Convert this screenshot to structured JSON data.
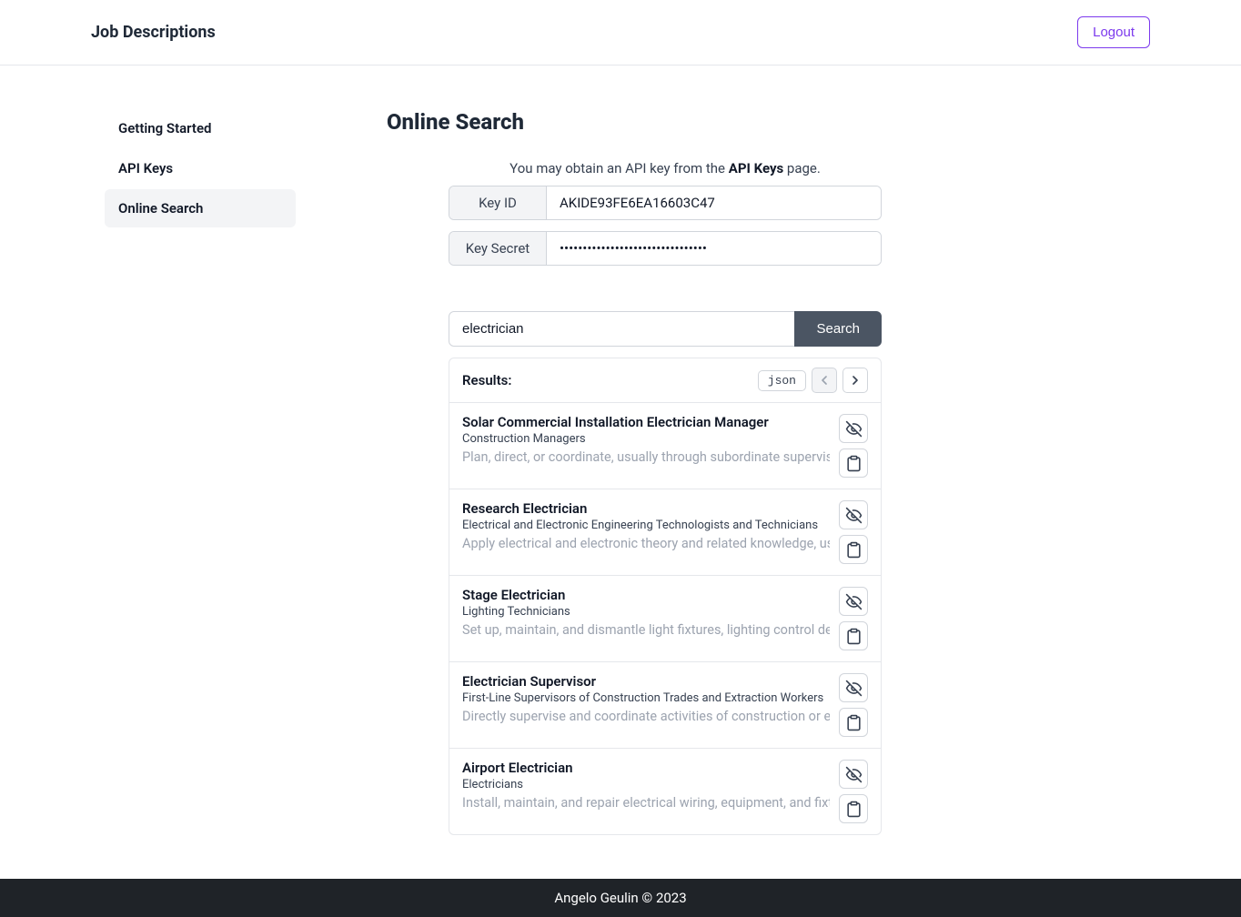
{
  "header": {
    "title": "Job Descriptions",
    "logout": "Logout"
  },
  "sidebar": {
    "items": [
      {
        "label": "Getting Started",
        "active": false
      },
      {
        "label": "API Keys",
        "active": false
      },
      {
        "label": "Online Search",
        "active": true
      }
    ]
  },
  "page": {
    "title": "Online Search",
    "info_prefix": "You may obtain an API key from the ",
    "info_link": "API Keys",
    "info_suffix": " page.",
    "key_id_label": "Key ID",
    "key_id_value": "AKIDE93FE6EA16603C47",
    "key_secret_label": "Key Secret",
    "key_secret_value": "••••••••••••••••••••••••••••••••",
    "search_value": "electrician",
    "search_button": "Search",
    "results_label": "Results:",
    "json_badge": "json"
  },
  "results": [
    {
      "title": "Solar Commercial Installation Electrician Manager",
      "category": "Construction Managers",
      "description": "Plan, direct, or coordinate, usually through subordinate supervisory p …"
    },
    {
      "title": "Research Electrician",
      "category": "Electrical and Electronic Engineering Technologists and Technicians",
      "description": "Apply electrical and electronic theory and related knowledge, usually …"
    },
    {
      "title": "Stage Electrician",
      "category": "Lighting Technicians",
      "description": "Set up, maintain, and dismantle light fixtures, lighting control devic …"
    },
    {
      "title": "Electrician Supervisor",
      "category": "First-Line Supervisors of Construction Trades and Extraction Workers",
      "description": "Directly supervise and coordinate activities of construction or extrac …"
    },
    {
      "title": "Airport Electrician",
      "category": "Electricians",
      "description": "Install, maintain, and repair electrical wiring, equipment, and fixtur …"
    }
  ],
  "footer": {
    "text": "Angelo Geulin © 2023"
  }
}
